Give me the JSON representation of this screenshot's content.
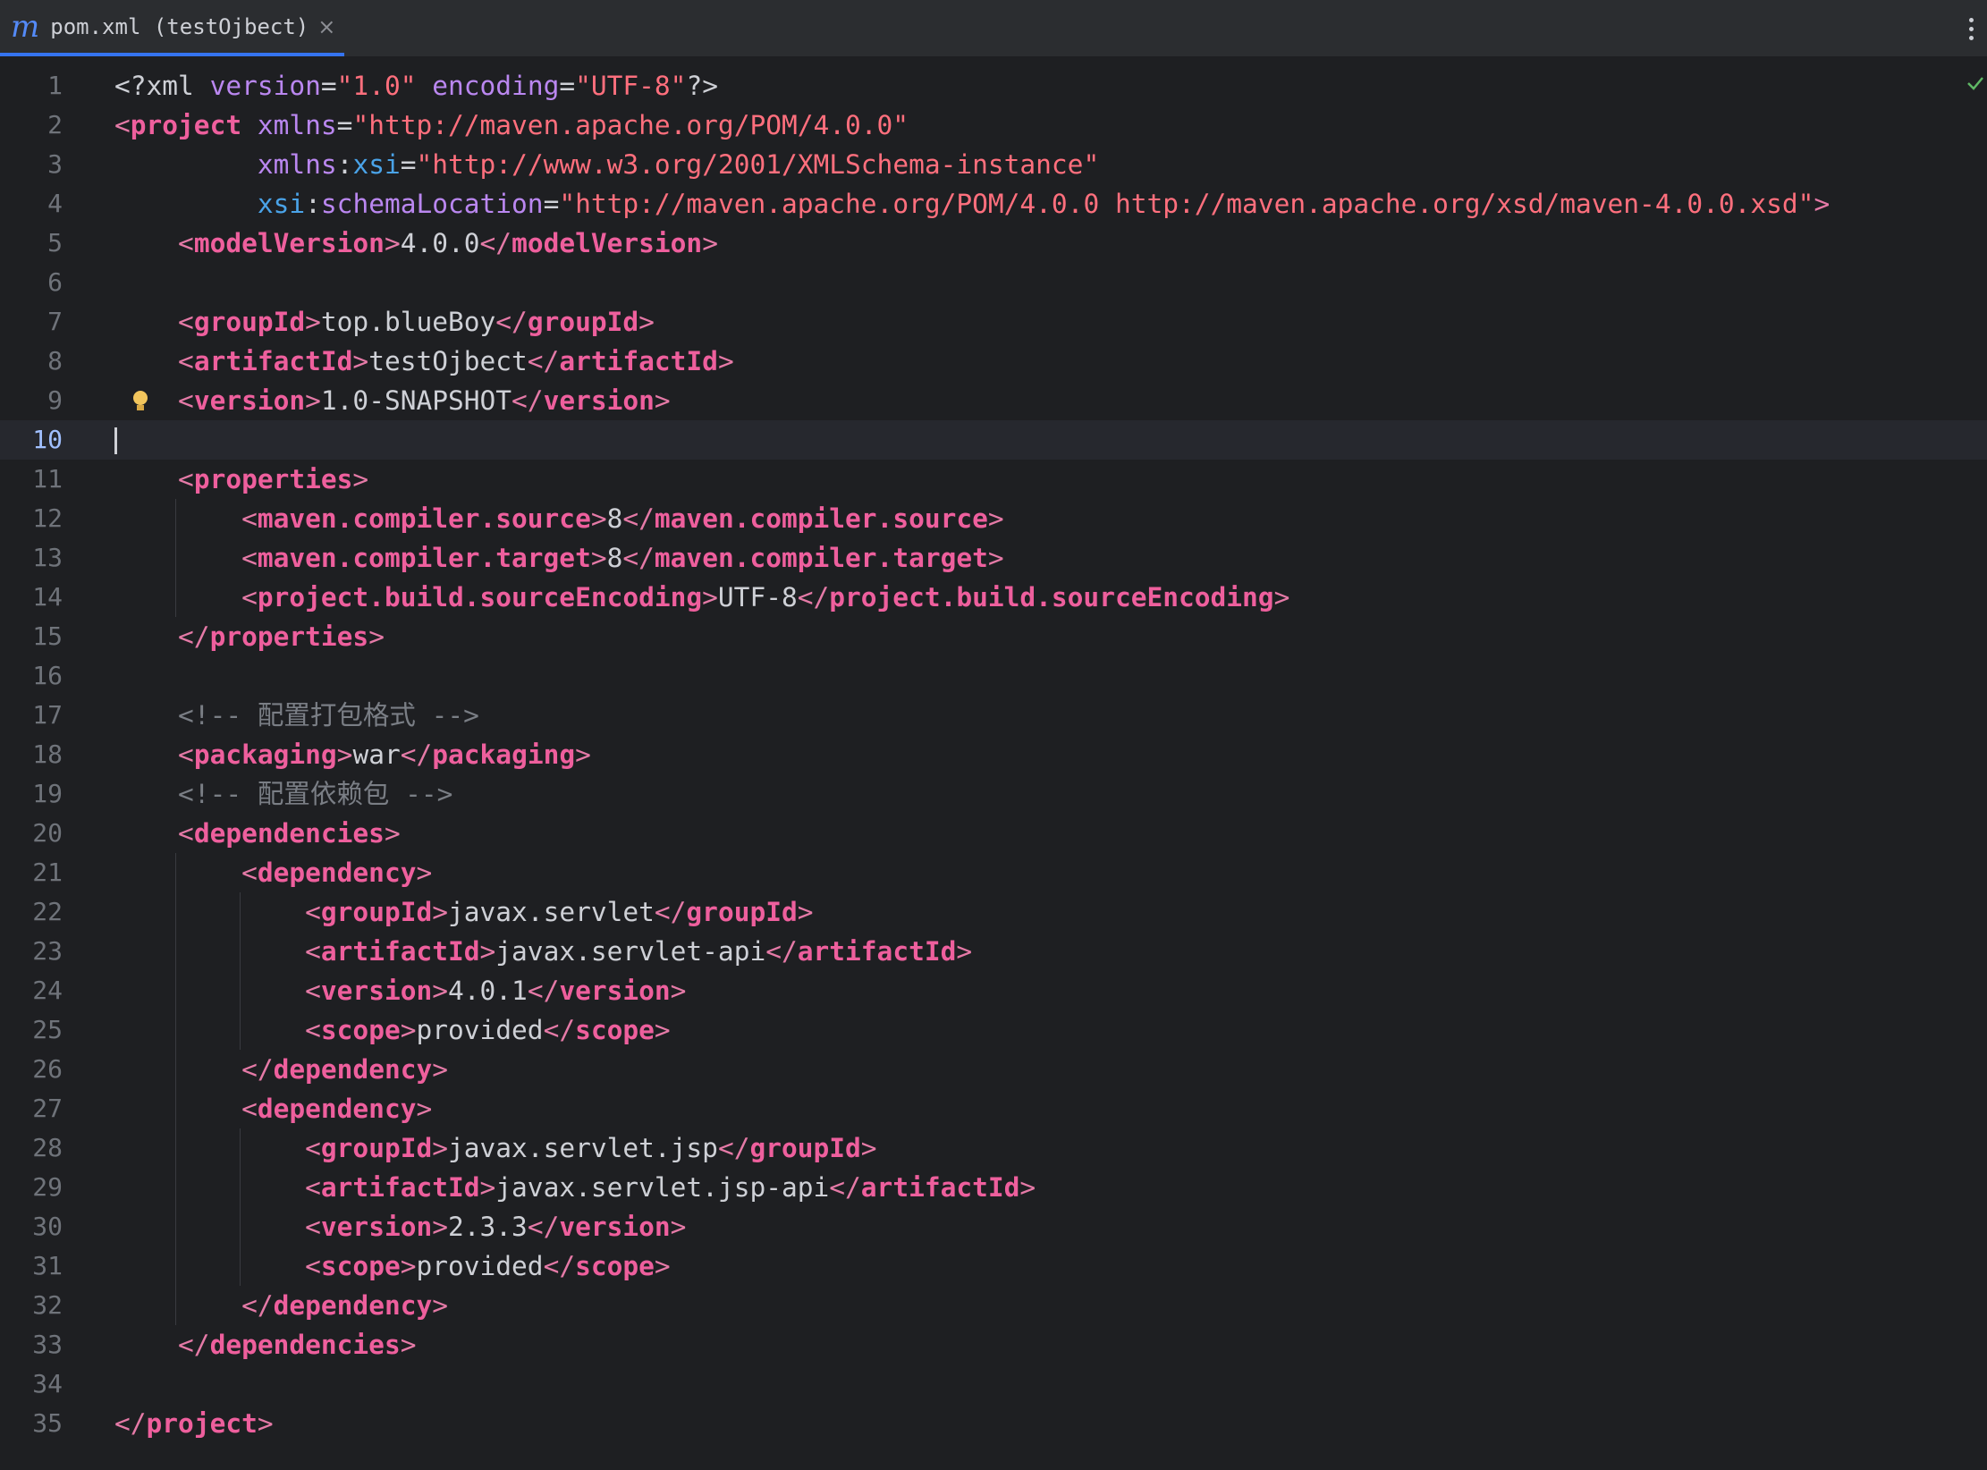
{
  "tab": {
    "icon": "maven-m-icon",
    "icon_glyph": "m",
    "title": "pom.xml (testOjbect)",
    "close_glyph": "×"
  },
  "editor": {
    "current_line": 10,
    "lines": [
      {
        "n": "1",
        "tokens": [
          [
            "decl",
            "<?xml "
          ],
          [
            "attr",
            "version"
          ],
          [
            "decl",
            "="
          ],
          [
            "val",
            "\"1.0\""
          ],
          [
            "decl",
            " "
          ],
          [
            "attr",
            "encoding"
          ],
          [
            "decl",
            "="
          ],
          [
            "val",
            "\"UTF-8\""
          ],
          [
            "decl",
            "?>"
          ]
        ]
      },
      {
        "n": "2",
        "tokens": [
          [
            "bracket",
            "<"
          ],
          [
            "name",
            "project"
          ],
          [
            "text",
            " "
          ],
          [
            "attr",
            "xmlns"
          ],
          [
            "text",
            "="
          ],
          [
            "val",
            "\"http://maven.apache.org/POM/4.0.0\""
          ]
        ]
      },
      {
        "n": "3",
        "tokens": [
          [
            "text",
            "         "
          ],
          [
            "attr",
            "xmlns"
          ],
          [
            "text",
            ":"
          ],
          [
            "ns",
            "xsi"
          ],
          [
            "text",
            "="
          ],
          [
            "val",
            "\"http://www.w3.org/2001/XMLSchema-instance\""
          ]
        ]
      },
      {
        "n": "4",
        "tokens": [
          [
            "text",
            "         "
          ],
          [
            "ns",
            "xsi"
          ],
          [
            "text",
            ":"
          ],
          [
            "attr",
            "schemaLocation"
          ],
          [
            "text",
            "="
          ],
          [
            "val",
            "\"http://maven.apache.org/POM/4.0.0 http://maven.apache.org/xsd/maven-4.0.0.xsd\""
          ],
          [
            "bracket",
            ">"
          ]
        ]
      },
      {
        "n": "5",
        "tokens": [
          [
            "text",
            "    "
          ],
          [
            "bracket",
            "<"
          ],
          [
            "name",
            "modelVersion"
          ],
          [
            "bracket",
            ">"
          ],
          [
            "text",
            "4.0.0"
          ],
          [
            "bracket",
            "</"
          ],
          [
            "name",
            "modelVersion"
          ],
          [
            "bracket",
            ">"
          ]
        ]
      },
      {
        "n": "6",
        "tokens": []
      },
      {
        "n": "7",
        "tokens": [
          [
            "text",
            "    "
          ],
          [
            "bracket",
            "<"
          ],
          [
            "name",
            "groupId"
          ],
          [
            "bracket",
            ">"
          ],
          [
            "text",
            "top.blueBoy"
          ],
          [
            "bracket",
            "</"
          ],
          [
            "name",
            "groupId"
          ],
          [
            "bracket",
            ">"
          ]
        ]
      },
      {
        "n": "8",
        "tokens": [
          [
            "text",
            "    "
          ],
          [
            "bracket",
            "<"
          ],
          [
            "name",
            "artifactId"
          ],
          [
            "bracket",
            ">"
          ],
          [
            "text",
            "testOjbect"
          ],
          [
            "bracket",
            "</"
          ],
          [
            "name",
            "artifactId"
          ],
          [
            "bracket",
            ">"
          ]
        ]
      },
      {
        "n": "9",
        "tokens": [
          [
            "text",
            "    "
          ],
          [
            "bracket",
            "<"
          ],
          [
            "name",
            "version"
          ],
          [
            "bracket",
            ">"
          ],
          [
            "text",
            "1.0-SNAPSHOT"
          ],
          [
            "bracket",
            "</"
          ],
          [
            "name",
            "version"
          ],
          [
            "bracket",
            ">"
          ]
        ]
      },
      {
        "n": "10",
        "tokens": []
      },
      {
        "n": "11",
        "tokens": [
          [
            "text",
            "    "
          ],
          [
            "bracket",
            "<"
          ],
          [
            "name",
            "properties"
          ],
          [
            "bracket",
            ">"
          ]
        ]
      },
      {
        "n": "12",
        "tokens": [
          [
            "text",
            "        "
          ],
          [
            "bracket",
            "<"
          ],
          [
            "name",
            "maven.compiler.source"
          ],
          [
            "bracket",
            ">"
          ],
          [
            "text",
            "8"
          ],
          [
            "bracket",
            "</"
          ],
          [
            "name",
            "maven.compiler.source"
          ],
          [
            "bracket",
            ">"
          ]
        ]
      },
      {
        "n": "13",
        "tokens": [
          [
            "text",
            "        "
          ],
          [
            "bracket",
            "<"
          ],
          [
            "name",
            "maven.compiler.target"
          ],
          [
            "bracket",
            ">"
          ],
          [
            "text",
            "8"
          ],
          [
            "bracket",
            "</"
          ],
          [
            "name",
            "maven.compiler.target"
          ],
          [
            "bracket",
            ">"
          ]
        ]
      },
      {
        "n": "14",
        "tokens": [
          [
            "text",
            "        "
          ],
          [
            "bracket",
            "<"
          ],
          [
            "name",
            "project.build.sourceEncoding"
          ],
          [
            "bracket",
            ">"
          ],
          [
            "text",
            "UTF-8"
          ],
          [
            "bracket",
            "</"
          ],
          [
            "name",
            "project.build.sourceEncoding"
          ],
          [
            "bracket",
            ">"
          ]
        ]
      },
      {
        "n": "15",
        "tokens": [
          [
            "text",
            "    "
          ],
          [
            "bracket",
            "</"
          ],
          [
            "name",
            "properties"
          ],
          [
            "bracket",
            ">"
          ]
        ]
      },
      {
        "n": "16",
        "tokens": []
      },
      {
        "n": "17",
        "tokens": [
          [
            "text",
            "    "
          ],
          [
            "comment",
            "<!-- 配置打包格式 -->"
          ]
        ]
      },
      {
        "n": "18",
        "tokens": [
          [
            "text",
            "    "
          ],
          [
            "bracket",
            "<"
          ],
          [
            "name",
            "packaging"
          ],
          [
            "bracket",
            ">"
          ],
          [
            "text",
            "war"
          ],
          [
            "bracket",
            "</"
          ],
          [
            "name",
            "packaging"
          ],
          [
            "bracket",
            ">"
          ]
        ]
      },
      {
        "n": "19",
        "tokens": [
          [
            "text",
            "    "
          ],
          [
            "comment",
            "<!-- 配置依赖包 -->"
          ]
        ]
      },
      {
        "n": "20",
        "tokens": [
          [
            "text",
            "    "
          ],
          [
            "bracket",
            "<"
          ],
          [
            "name",
            "dependencies"
          ],
          [
            "bracket",
            ">"
          ]
        ]
      },
      {
        "n": "21",
        "tokens": [
          [
            "text",
            "        "
          ],
          [
            "bracket",
            "<"
          ],
          [
            "name",
            "dependency"
          ],
          [
            "bracket",
            ">"
          ]
        ]
      },
      {
        "n": "22",
        "tokens": [
          [
            "text",
            "            "
          ],
          [
            "bracket",
            "<"
          ],
          [
            "name",
            "groupId"
          ],
          [
            "bracket",
            ">"
          ],
          [
            "text",
            "javax.servlet"
          ],
          [
            "bracket",
            "</"
          ],
          [
            "name",
            "groupId"
          ],
          [
            "bracket",
            ">"
          ]
        ]
      },
      {
        "n": "23",
        "tokens": [
          [
            "text",
            "            "
          ],
          [
            "bracket",
            "<"
          ],
          [
            "name",
            "artifactId"
          ],
          [
            "bracket",
            ">"
          ],
          [
            "text",
            "javax.servlet-api"
          ],
          [
            "bracket",
            "</"
          ],
          [
            "name",
            "artifactId"
          ],
          [
            "bracket",
            ">"
          ]
        ]
      },
      {
        "n": "24",
        "tokens": [
          [
            "text",
            "            "
          ],
          [
            "bracket",
            "<"
          ],
          [
            "name",
            "version"
          ],
          [
            "bracket",
            ">"
          ],
          [
            "text",
            "4.0.1"
          ],
          [
            "bracket",
            "</"
          ],
          [
            "name",
            "version"
          ],
          [
            "bracket",
            ">"
          ]
        ]
      },
      {
        "n": "25",
        "tokens": [
          [
            "text",
            "            "
          ],
          [
            "bracket",
            "<"
          ],
          [
            "name",
            "scope"
          ],
          [
            "bracket",
            ">"
          ],
          [
            "text",
            "provided"
          ],
          [
            "bracket",
            "</"
          ],
          [
            "name",
            "scope"
          ],
          [
            "bracket",
            ">"
          ]
        ]
      },
      {
        "n": "26",
        "tokens": [
          [
            "text",
            "        "
          ],
          [
            "bracket",
            "</"
          ],
          [
            "name",
            "dependency"
          ],
          [
            "bracket",
            ">"
          ]
        ]
      },
      {
        "n": "27",
        "tokens": [
          [
            "text",
            "        "
          ],
          [
            "bracket",
            "<"
          ],
          [
            "name",
            "dependency"
          ],
          [
            "bracket",
            ">"
          ]
        ]
      },
      {
        "n": "28",
        "tokens": [
          [
            "text",
            "            "
          ],
          [
            "bracket",
            "<"
          ],
          [
            "name",
            "groupId"
          ],
          [
            "bracket",
            ">"
          ],
          [
            "text",
            "javax.servlet.jsp"
          ],
          [
            "bracket",
            "</"
          ],
          [
            "name",
            "groupId"
          ],
          [
            "bracket",
            ">"
          ]
        ]
      },
      {
        "n": "29",
        "tokens": [
          [
            "text",
            "            "
          ],
          [
            "bracket",
            "<"
          ],
          [
            "name",
            "artifactId"
          ],
          [
            "bracket",
            ">"
          ],
          [
            "text",
            "javax.servlet.jsp-api"
          ],
          [
            "bracket",
            "</"
          ],
          [
            "name",
            "artifactId"
          ],
          [
            "bracket",
            ">"
          ]
        ]
      },
      {
        "n": "30",
        "tokens": [
          [
            "text",
            "            "
          ],
          [
            "bracket",
            "<"
          ],
          [
            "name",
            "version"
          ],
          [
            "bracket",
            ">"
          ],
          [
            "text",
            "2.3.3"
          ],
          [
            "bracket",
            "</"
          ],
          [
            "name",
            "version"
          ],
          [
            "bracket",
            ">"
          ]
        ]
      },
      {
        "n": "31",
        "tokens": [
          [
            "text",
            "            "
          ],
          [
            "bracket",
            "<"
          ],
          [
            "name",
            "scope"
          ],
          [
            "bracket",
            ">"
          ],
          [
            "text",
            "provided"
          ],
          [
            "bracket",
            "</"
          ],
          [
            "name",
            "scope"
          ],
          [
            "bracket",
            ">"
          ]
        ]
      },
      {
        "n": "32",
        "tokens": [
          [
            "text",
            "        "
          ],
          [
            "bracket",
            "</"
          ],
          [
            "name",
            "dependency"
          ],
          [
            "bracket",
            ">"
          ]
        ]
      },
      {
        "n": "33",
        "tokens": [
          [
            "text",
            "    "
          ],
          [
            "bracket",
            "</"
          ],
          [
            "name",
            "dependencies"
          ],
          [
            "bracket",
            ">"
          ]
        ]
      },
      {
        "n": "34",
        "tokens": []
      },
      {
        "n": "35",
        "tokens": [
          [
            "bracket",
            "</"
          ],
          [
            "name",
            "project"
          ],
          [
            "bracket",
            ">"
          ]
        ]
      }
    ]
  },
  "icons": {
    "intention": "lightbulb-icon",
    "inspection": "checkmark-icon",
    "more": "more-vertical-icon"
  },
  "colors": {
    "tag_name": "#ee5f9d",
    "attribute": "#ba87f0",
    "namespace": "#4aa3e8",
    "string_value": "#ff6f7d",
    "comment": "#7a7e85",
    "accent": "#3574f0"
  }
}
